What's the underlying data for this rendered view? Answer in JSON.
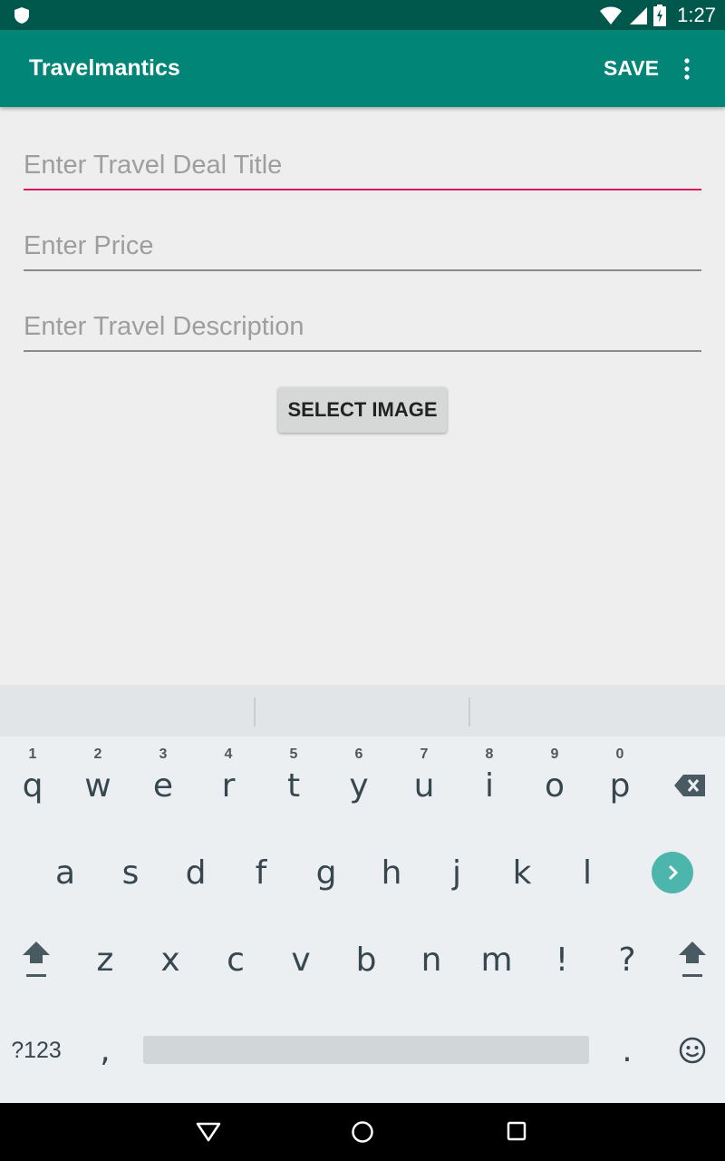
{
  "status_bar": {
    "time": "1:27"
  },
  "app_bar": {
    "title": "Travelmantics",
    "save_label": "SAVE"
  },
  "form": {
    "title_placeholder": "Enter Travel Deal Title",
    "price_placeholder": "Enter Price",
    "description_placeholder": "Enter Travel Description",
    "select_image_label": "SELECT IMAGE"
  },
  "keyboard": {
    "row1": [
      {
        "key": "q",
        "hint": "1"
      },
      {
        "key": "w",
        "hint": "2"
      },
      {
        "key": "e",
        "hint": "3"
      },
      {
        "key": "r",
        "hint": "4"
      },
      {
        "key": "t",
        "hint": "5"
      },
      {
        "key": "y",
        "hint": "6"
      },
      {
        "key": "u",
        "hint": "7"
      },
      {
        "key": "i",
        "hint": "8"
      },
      {
        "key": "o",
        "hint": "9"
      },
      {
        "key": "p",
        "hint": "0"
      }
    ],
    "row2": [
      "a",
      "s",
      "d",
      "f",
      "g",
      "h",
      "j",
      "k",
      "l"
    ],
    "row3": [
      "z",
      "x",
      "c",
      "v",
      "b",
      "n",
      "m",
      "!",
      "?"
    ],
    "symbols_label": "?123",
    "comma": ",",
    "period": ".",
    "enter_color": "#4db6ac"
  },
  "colors": {
    "status_bar": "#00574b",
    "app_bar": "#008577",
    "accent": "#d81b60"
  }
}
